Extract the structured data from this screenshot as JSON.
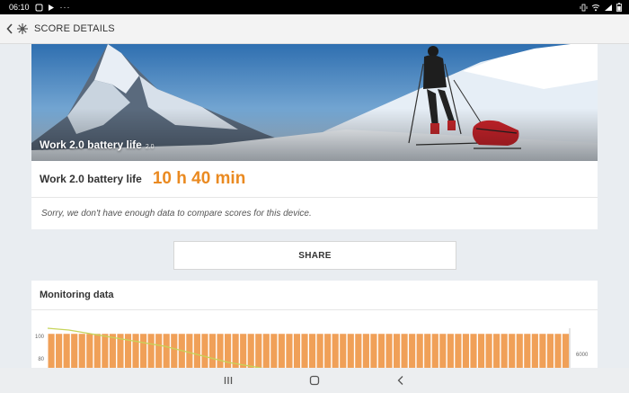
{
  "status_bar": {
    "time": "06:10",
    "left_icons": [
      "notification-icon",
      "media-icon",
      "more-dots-icon"
    ],
    "right_icons": [
      "vibrate-icon",
      "wifi-icon",
      "signal-icon",
      "battery-icon"
    ]
  },
  "app_bar": {
    "title": "SCORE DETAILS"
  },
  "hero": {
    "label": "Work 2.0 battery life",
    "version": "2.0"
  },
  "score": {
    "name": "Work 2.0 battery life",
    "value": "10 h 40 min",
    "accent_color": "#ea8a21"
  },
  "note": {
    "text": "Sorry, we don't have enough data to compare scores for this device."
  },
  "share": {
    "label": "SHARE"
  },
  "monitoring": {
    "title": "Monitoring data"
  },
  "chart_data": {
    "type": "bar",
    "title": "",
    "y_left_tick_labels": [
      "100",
      "80"
    ],
    "y_right_tick_labels": [
      "6000"
    ],
    "bar_color": "#f0a058",
    "line_color": "#c6d45a",
    "bar_values": [
      99,
      99,
      99,
      99,
      99,
      99,
      99,
      99,
      99,
      99,
      99,
      99,
      99,
      99,
      99,
      99,
      99,
      99,
      99,
      99,
      99,
      99,
      99,
      99,
      99,
      99,
      99,
      99,
      99,
      99,
      99,
      99,
      99,
      99,
      99,
      99,
      99,
      99,
      99,
      99,
      99,
      99,
      99,
      99,
      99,
      99,
      99,
      99,
      99,
      99,
      99,
      99,
      99,
      99,
      99,
      99,
      99,
      99,
      99,
      99,
      99,
      99,
      99,
      99,
      99,
      99,
      99,
      99
    ],
    "line_values": [
      100,
      99,
      98,
      96,
      94,
      92,
      90,
      88,
      86,
      84,
      82,
      80,
      77,
      74,
      71,
      68,
      65,
      62,
      60,
      58,
      56,
      54,
      52,
      50,
      48,
      46,
      44,
      42
    ],
    "ylim_left": [
      70,
      100
    ]
  },
  "nav": {
    "icons": [
      "recent-apps-icon",
      "home-icon",
      "back-icon"
    ]
  }
}
